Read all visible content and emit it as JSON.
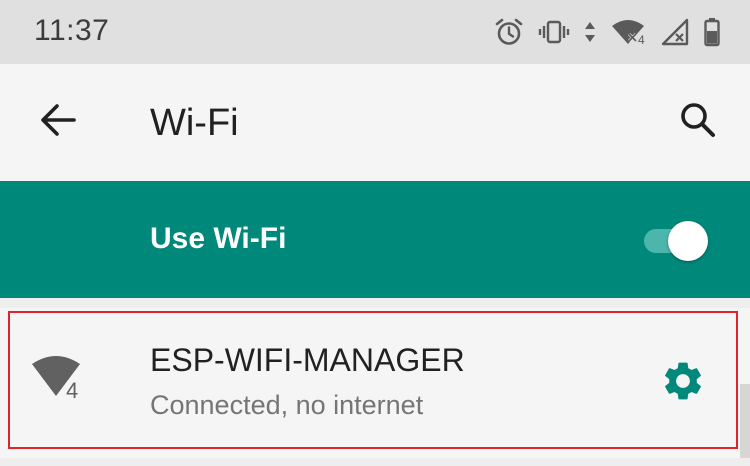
{
  "status_bar": {
    "time": "11:37",
    "icons": [
      "alarm-icon",
      "vibrate-icon",
      "data-arrows-icon",
      "wifi-no-internet-icon",
      "cell-signal-off-icon",
      "battery-icon"
    ]
  },
  "app_bar": {
    "title": "Wi-Fi",
    "back_icon": "arrow-back-icon",
    "search_icon": "search-icon"
  },
  "master_switch": {
    "label": "Use Wi-Fi",
    "on": true
  },
  "networks": [
    {
      "name": "ESP-WIFI-MANAGER",
      "status": "Connected, no internet",
      "signal_icon": "wifi-signal-4-icon",
      "signal_badge": "4",
      "settings_icon": "gear-icon"
    }
  ],
  "colors": {
    "accent": "#00897b",
    "highlight_border": "#e0222a",
    "status_bar_bg": "#e0e0e0"
  }
}
